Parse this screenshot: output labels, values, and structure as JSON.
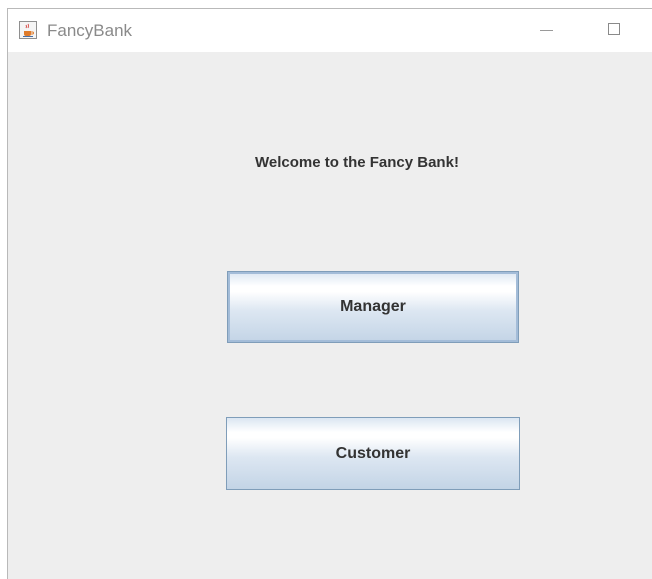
{
  "window": {
    "title": "FancyBank",
    "app_icon": "java-cup-icon",
    "controls": {
      "minimize_icon": "minimize-icon",
      "maximize_icon": "maximize-icon"
    }
  },
  "main": {
    "welcome_text": "Welcome to the Fancy Bank!",
    "buttons": {
      "manager_label": "Manager",
      "customer_label": "Customer"
    }
  },
  "colors": {
    "background": "#eeeeee",
    "button_border": "#7f9db9",
    "text": "#333333"
  }
}
